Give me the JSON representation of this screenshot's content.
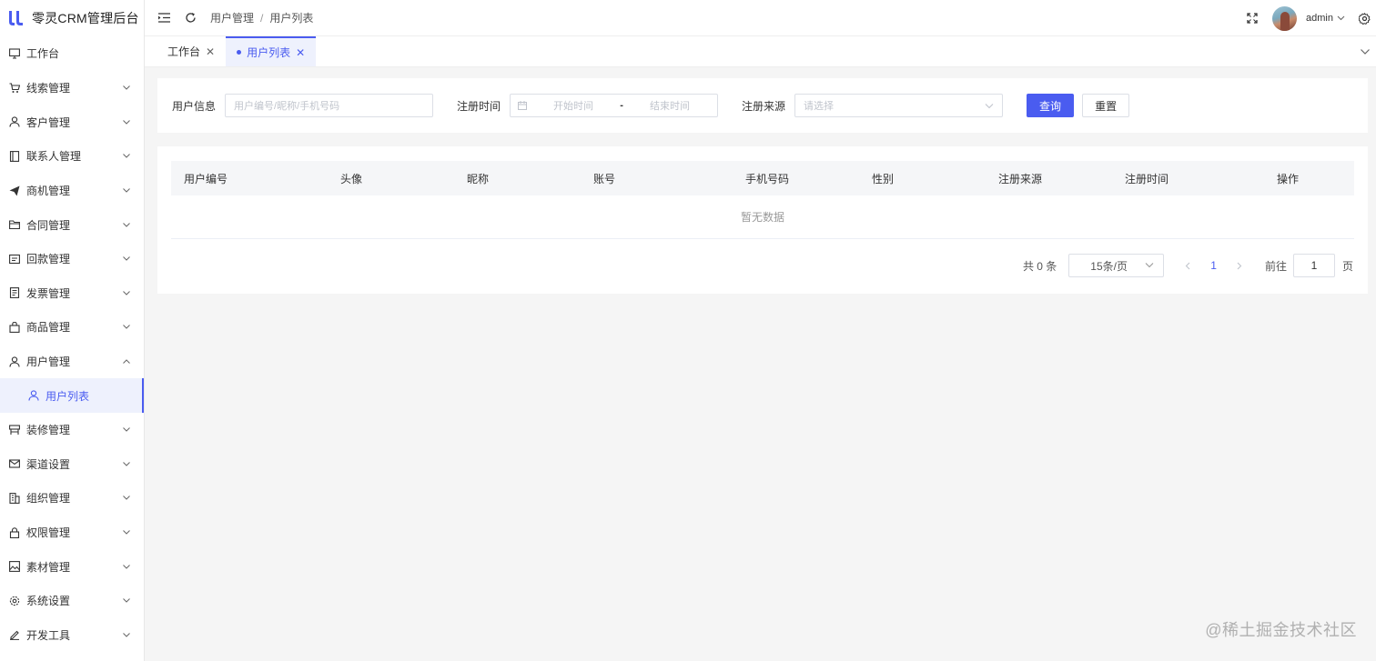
{
  "app": {
    "title": "零灵CRM管理后台"
  },
  "colors": {
    "primary": "#4a5cf0",
    "sidebar_active_bg": "#eef1fd",
    "page_bg": "#f5f5f5"
  },
  "sidebar": {
    "items": [
      {
        "label": "工作台",
        "icon": "monitor-icon"
      },
      {
        "label": "线索管理",
        "icon": "cart-icon"
      },
      {
        "label": "客户管理",
        "icon": "user-icon"
      },
      {
        "label": "联系人管理",
        "icon": "contact-book-icon"
      },
      {
        "label": "商机管理",
        "icon": "paper-plane-icon"
      },
      {
        "label": "合同管理",
        "icon": "folder-icon"
      },
      {
        "label": "回款管理",
        "icon": "payment-icon"
      },
      {
        "label": "发票管理",
        "icon": "invoice-icon"
      },
      {
        "label": "商品管理",
        "icon": "bag-icon"
      },
      {
        "label": "用户管理",
        "icon": "user-icon"
      },
      {
        "label": "用户列表",
        "icon": "user-icon"
      },
      {
        "label": "装修管理",
        "icon": "decor-icon"
      },
      {
        "label": "渠道设置",
        "icon": "mail-icon"
      },
      {
        "label": "组织管理",
        "icon": "office-icon"
      },
      {
        "label": "权限管理",
        "icon": "lock-icon"
      },
      {
        "label": "素材管理",
        "icon": "image-icon"
      },
      {
        "label": "系统设置",
        "icon": "gear-icon"
      },
      {
        "label": "开发工具",
        "icon": "edit-icon"
      }
    ]
  },
  "header": {
    "breadcrumb": [
      "用户管理",
      "用户列表"
    ],
    "breadcrumb_sep": "/",
    "user_name": "admin"
  },
  "tabs": [
    {
      "label": "工作台",
      "active": false
    },
    {
      "label": "用户列表",
      "active": true
    }
  ],
  "filter": {
    "user_info_label": "用户信息",
    "user_info_placeholder": "用户编号/昵称/手机号码",
    "reg_time_label": "注册时间",
    "start_placeholder": "开始时间",
    "range_sep": "-",
    "end_placeholder": "结束时间",
    "source_label": "注册来源",
    "source_placeholder": "请选择",
    "query_button": "查询",
    "reset_button": "重置"
  },
  "table": {
    "columns": [
      "用户编号",
      "头像",
      "昵称",
      "账号",
      "手机号码",
      "性别",
      "注册来源",
      "注册时间",
      "操作"
    ],
    "rows": [],
    "empty_text": "暂无数据"
  },
  "pagination": {
    "total_text": "共 0 条",
    "page_size": "15条/页",
    "current_page": "1",
    "goto_label": "前往",
    "goto_value": "1",
    "page_unit": "页"
  },
  "watermark": "@稀土掘金技术社区"
}
